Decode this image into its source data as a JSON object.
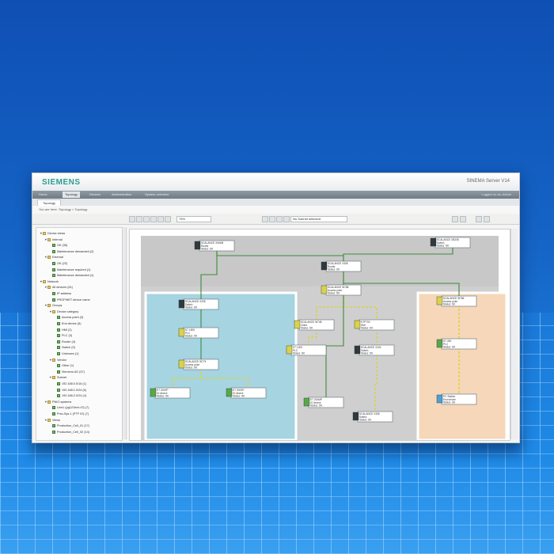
{
  "window": {
    "brand": "SIEMENS",
    "app_title": "SINEMA Server V14",
    "menu": [
      "Home",
      "Topology",
      "Devices",
      "Administration",
      "System overview"
    ],
    "active_menu_index": 1,
    "menu_right": "Logged on as: Admin",
    "tab": "Topology",
    "breadcrumb": "You are here: Topology > Topology"
  },
  "toolbar": {
    "zoom_value": "75%",
    "layer_select": "No Subnet selected"
  },
  "sidebar": {
    "tree": [
      {
        "level": 0,
        "label": "Device views",
        "toggle": "▼",
        "icon": "folder"
      },
      {
        "level": 1,
        "label": "Internal",
        "toggle": "▼",
        "icon": "folder"
      },
      {
        "level": 2,
        "label": "OK (35)",
        "toggle": "",
        "icon": "dev"
      },
      {
        "level": 2,
        "label": "Maintenance demanded (2)",
        "toggle": "",
        "icon": "dev"
      },
      {
        "level": 1,
        "label": "External",
        "toggle": "▼",
        "icon": "folder"
      },
      {
        "level": 2,
        "label": "OK (22)",
        "toggle": "",
        "icon": "dev"
      },
      {
        "level": 2,
        "label": "Maintenance required (1)",
        "toggle": "",
        "icon": "dev"
      },
      {
        "level": 2,
        "label": "Maintenance demanded (1)",
        "toggle": "",
        "icon": "dev"
      },
      {
        "level": 0,
        "label": "Network",
        "toggle": "▼",
        "icon": "folder"
      },
      {
        "level": 1,
        "label": "All devices (61)",
        "toggle": "▼",
        "icon": "folder"
      },
      {
        "level": 2,
        "label": "IP address",
        "toggle": "",
        "icon": "dev"
      },
      {
        "level": 2,
        "label": "PROFINET device name",
        "toggle": "",
        "icon": "dev"
      },
      {
        "level": 1,
        "label": "Groups",
        "toggle": "▼",
        "icon": "folder"
      },
      {
        "level": 2,
        "label": "Device category",
        "toggle": "▼",
        "icon": "folder"
      },
      {
        "level": 3,
        "label": "Access point (3)",
        "toggle": "",
        "icon": "dev"
      },
      {
        "level": 3,
        "label": "End device (6)",
        "toggle": "",
        "icon": "dev"
      },
      {
        "level": 3,
        "label": "HMI (2)",
        "toggle": "",
        "icon": "dev"
      },
      {
        "level": 3,
        "label": "PLC (3)",
        "toggle": "",
        "icon": "dev"
      },
      {
        "level": 3,
        "label": "Router (4)",
        "toggle": "",
        "icon": "dev"
      },
      {
        "level": 3,
        "label": "Switch (9)",
        "toggle": "",
        "icon": "dev"
      },
      {
        "level": 3,
        "label": "Unknown (1)",
        "toggle": "",
        "icon": "dev"
      },
      {
        "level": 2,
        "label": "Vendor",
        "toggle": "▼",
        "icon": "folder"
      },
      {
        "level": 3,
        "label": "Other (1)",
        "toggle": "",
        "icon": "dev"
      },
      {
        "level": 3,
        "label": "Siemens AG (37)",
        "toggle": "",
        "icon": "dev"
      },
      {
        "level": 2,
        "label": "Subnet",
        "toggle": "▼",
        "icon": "folder"
      },
      {
        "level": 3,
        "label": "192.168.0.0/16 (1)",
        "toggle": "",
        "icon": "dev"
      },
      {
        "level": 3,
        "label": "192.168.1.0/24 (6)",
        "toggle": "",
        "icon": "dev"
      },
      {
        "level": 3,
        "label": "192.168.2.0/24 (4)",
        "toggle": "",
        "icon": "dev"
      },
      {
        "level": 1,
        "label": "PNIO systems",
        "toggle": "▼",
        "icon": "folder"
      },
      {
        "level": 2,
        "label": "Line1 (pg121hmi-IO) (7)",
        "toggle": "",
        "icon": "dev"
      },
      {
        "level": 2,
        "label": "Pnio-Sys-1 (PTF IO) (7)",
        "toggle": "",
        "icon": "dev"
      },
      {
        "level": 1,
        "label": "Views",
        "toggle": "▼",
        "icon": "folder"
      },
      {
        "level": 2,
        "label": "Production_Cell_01 (17)",
        "toggle": "",
        "icon": "dev"
      },
      {
        "level": 2,
        "label": "Production_Cell_02 (14)",
        "toggle": "",
        "icon": "dev"
      }
    ]
  },
  "topology": {
    "colors": {
      "backbone": "#c8c8c8",
      "cell_a": "#a6d4e0",
      "cell_b": "#f6d7b9",
      "link": "#3f8a3c",
      "link_dashed": "#d7d34c"
    },
    "nodes": [
      {
        "label": "SCALANCE XM408",
        "sub": "Router",
        "status": "Status: OK",
        "icon": "dark"
      },
      {
        "label": "SCALANCE XB208",
        "sub": "Switch",
        "status": "Status: OK",
        "icon": "dark"
      },
      {
        "label": "SCALANCE X308",
        "sub": "Router",
        "status": "Status: OK",
        "icon": "dark"
      },
      {
        "label": "SCALANCE W788",
        "sub": "Access point",
        "status": "Status: OK",
        "icon": "star"
      },
      {
        "label": "SCALANCE X208",
        "sub": "Switch",
        "status": "Status: OK",
        "icon": "dark"
      },
      {
        "label": "S7-1500",
        "sub": "PLC",
        "status": "Status: OK",
        "icon": "star"
      },
      {
        "label": "SCALANCE W774",
        "sub": "Access point",
        "status": "Status: OK",
        "icon": "star"
      },
      {
        "label": "ET 200SP",
        "sub": "IO device",
        "status": "Status: OK",
        "icon": "green"
      },
      {
        "label": "ET 200SP",
        "sub": "IO device",
        "status": "Status: OK",
        "icon": "green"
      },
      {
        "label": "SCALANCE W748",
        "sub": "Client",
        "status": "Status: OK",
        "icon": "star"
      },
      {
        "label": "S7-1200",
        "sub": "PLC",
        "status": "Status: OK",
        "icon": "star"
      },
      {
        "label": "KTP700",
        "sub": "HMI",
        "status": "Status: OK",
        "icon": "star"
      },
      {
        "label": "SCALANCE X204",
        "sub": "Switch",
        "status": "Status: OK",
        "icon": "dark"
      },
      {
        "label": "ET 200MP",
        "sub": "IO device",
        "status": "Status: OK",
        "icon": "green"
      },
      {
        "label": "SCALANCE X308",
        "sub": "Switch",
        "status": "Status: OK",
        "icon": "dark"
      },
      {
        "label": "SCALANCE W786",
        "sub": "Access point",
        "status": "Status: OK",
        "icon": "star"
      },
      {
        "label": "S7-300",
        "sub": "PLC",
        "status": "Status: OK",
        "icon": "green"
      },
      {
        "label": "PC Station",
        "sub": "End device",
        "status": "Status: OK",
        "icon": "alert"
      }
    ]
  }
}
